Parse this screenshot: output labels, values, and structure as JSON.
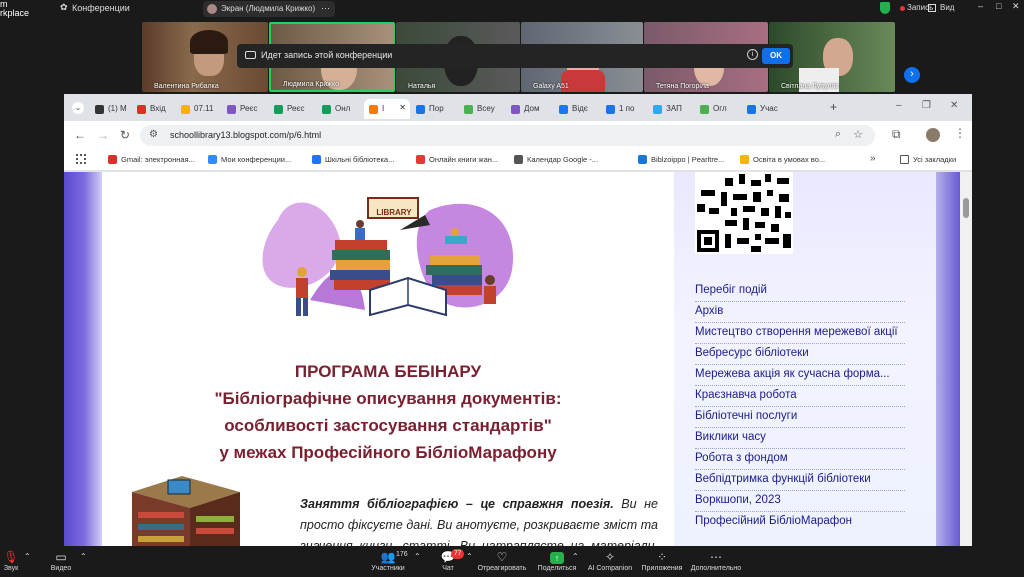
{
  "zoom": {
    "brand": "m\nrkplace",
    "conference_label": "Конференции",
    "share_label": "Экран (Людмила Крижко)",
    "record_label": "Запись",
    "view_label": "Вид",
    "recording_banner": "Идет запись этой конференции",
    "ok_label": "OK",
    "participants": [
      {
        "name": "Валентина Рибалка"
      },
      {
        "name": "Людмила Крижко"
      },
      {
        "name": "Наталья"
      },
      {
        "name": "Galaxy A51"
      },
      {
        "name": "Тетяна Погорілa"
      },
      {
        "name": "Світлана Лупуляк"
      }
    ],
    "participants_count": "176",
    "chat_badge": "77",
    "bottom": {
      "sound": "Звук",
      "video": "Видео",
      "participants": "Участники",
      "chat": "Чат",
      "react": "Отреагировать",
      "share": "Поделиться",
      "ai": "AI Companion",
      "apps": "Приложения",
      "more": "Дополнительно"
    }
  },
  "browser": {
    "tabs": [
      "(1) M",
      "Вхід",
      "07.11",
      "Реєс",
      "Реєс",
      "Онл",
      "I",
      "Пор",
      "Всеу",
      "Дом",
      "Відє",
      "1 по",
      "ЗАП",
      "Огл",
      "Учас"
    ],
    "url": "schoollibrary13.blogspot.com/p/6.html",
    "bookmarks": [
      "Gmail: электронная...",
      "Мои конференции...",
      "Шкільні бібліотека...",
      "Онлайн книги жан...",
      "Календар Google -...",
      "Biblzoippo | Pearltre...",
      "Освіта в умовах во..."
    ],
    "bookmarks_folder": "Усі закладки"
  },
  "page": {
    "library_sign": "LIBRARY",
    "heading": "ПРОГРАМА БЕБІНАРУ",
    "title_line1": "\"Бібліографічне описування документів:",
    "title_line2": "особливості застосування стандартів\"",
    "title_line3": "у межах Професійного БібліоМарафону",
    "para_bold": "Заняття бібліографією – це справжня поезія.",
    "para_rest": " Ви не просто фіксуєте дані. Ви анотуєте, розкриваєте зміст та значення книги, статті. Ви натрапляєте на матеріали, через які"
  },
  "sidebar": {
    "links": [
      "Перебіг подій",
      "Архів",
      "Мистецтво створення мережевої акції",
      "Вебресурс бібліотеки",
      "Мережева акція як сучасна форма...",
      "Краєзнавча робота",
      "Бібліотечні послуги",
      "Виклики часу",
      "Робота з фондом",
      "Вебпідтримка функцій бібліотеки",
      "Воркшопи, 2023",
      "Професійний БібліоМарафон"
    ]
  }
}
